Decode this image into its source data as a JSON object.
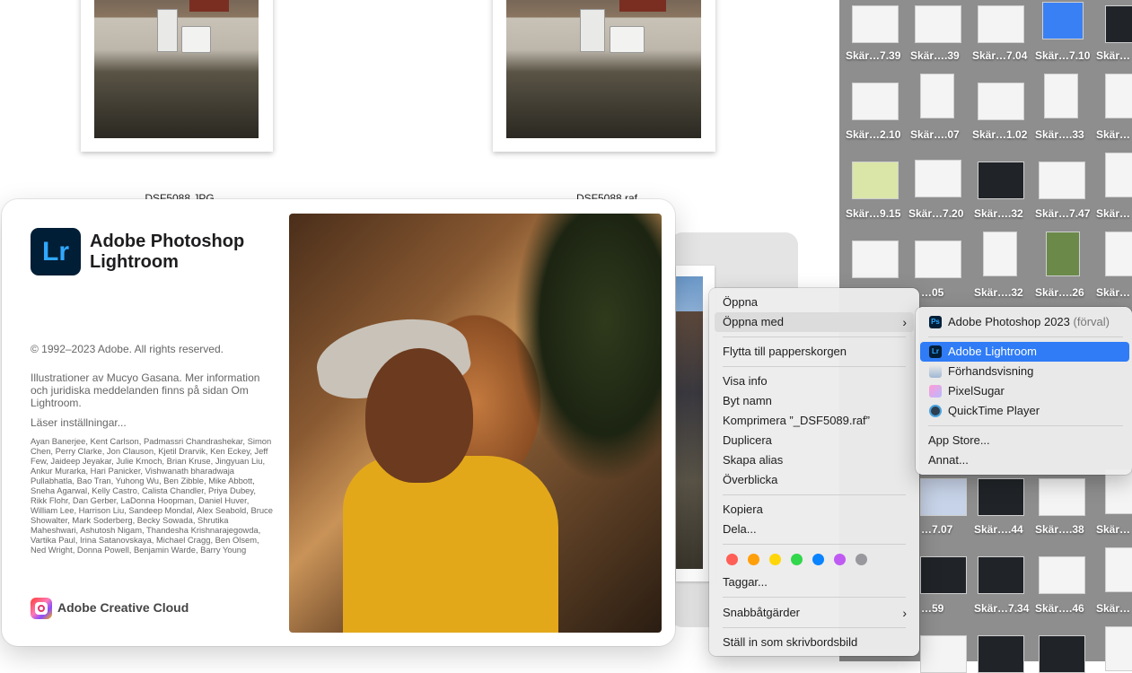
{
  "finder": {
    "files": [
      {
        "name": "DSF5088.JPG"
      },
      {
        "name": "DSF5088.raf"
      }
    ]
  },
  "splash": {
    "app_logo": "Lr",
    "app_name": "Adobe Photoshop Lightroom",
    "copyright": "© 1992–2023 Adobe. All rights reserved.",
    "illustration_credit": "Illustrationer av Mucyo Gasana. Mer information och juridiska meddelanden finns på sidan Om Lightroom.",
    "loading": "Läser inställningar...",
    "credits": "Ayan Banerjee, Kent Carlson, Padmassri Chandrashekar, Simon Chen, Perry Clarke, Jon Clauson, Kjetil Drarvik, Ken Eckey, Jeff Few, Jaideep Jeyakar, Julie Kmoch, Brian Kruse, Jingyuan Liu, Ankur Murarka, Hari Panicker, Vishwanath bharadwaja Pullabhatla, Bao Tran, Yuhong Wu, Ben Zibble, Mike Abbott, Sneha Agarwal, Kelly Castro, Calista Chandler, Priya Dubey, Rikk Flohr, Dan Gerber, LaDonna Hoopman, Daniel Huver, William Lee, Harrison Liu, Sandeep Mondal, Alex Seabold, Bruce Showalter, Mark Soderberg, Becky Sowada, Shrutika Maheshwari, Ashutosh Nigam, Thandesha Krishnarajegowda, Vartika Paul, Irina Satanovskaya, Michael Cragg, Ben Olsem, Ned Wright, Donna Powell, Benjamin Warde, Barry Young",
    "cc_label": "Adobe Creative Cloud"
  },
  "grid_labels": [
    [
      "Skär…7.39",
      "Skär….39",
      "Skär…7.04",
      "Skär…7.10",
      "Skär…"
    ],
    [
      "Skär…2.10",
      "Skär….07",
      "Skär…1.02",
      "Skär….33",
      "Skär…"
    ],
    [
      "Skär…9.15",
      "Skär…7.20",
      "Skär….32",
      "Skär…7.47",
      "Skär…"
    ],
    [
      "…05",
      "Skär….32",
      "Skär….26",
      "Skär…"
    ],
    [
      "…7.07",
      "Skär….44",
      "Skär….38",
      "Skär…"
    ],
    [
      "…59",
      "Skär…7.34",
      "Skär….46",
      "Skär…"
    ]
  ],
  "context_menu": {
    "open": "Öppna",
    "open_with": "Öppna med",
    "move_to_trash": "Flytta till papperskorgen",
    "get_info": "Visa info",
    "rename": "Byt namn",
    "compress": "Komprimera ”_DSF5089.raf”",
    "duplicate": "Duplicera",
    "make_alias": "Skapa alias",
    "quick_look": "Överblicka",
    "copy": "Kopiera",
    "share": "Dela...",
    "tag_colors": [
      "#ff5f57",
      "#ff9f0a",
      "#ffd60a",
      "#32d74b",
      "#0a84ff",
      "#bf5af2",
      "#98989d"
    ],
    "tags": "Taggar...",
    "quick_actions": "Snabbåtgärder",
    "set_desktop": "Ställ in som skrivbordsbild"
  },
  "open_with_menu": {
    "photoshop": "Adobe Photoshop 2023",
    "photoshop_default": "(förval)",
    "lightroom": "Adobe Lightroom",
    "preview": "Förhandsvisning",
    "pixelsugar": "PixelSugar",
    "quicktime": "QuickTime Player",
    "app_store": "App Store...",
    "other": "Annat..."
  }
}
